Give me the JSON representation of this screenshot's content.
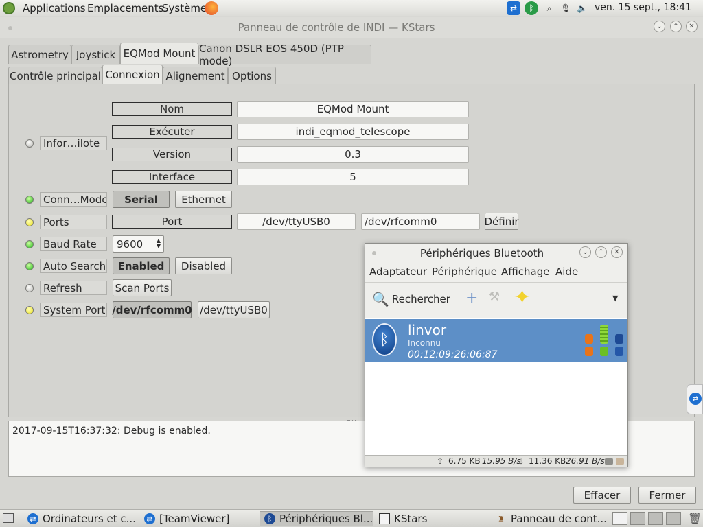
{
  "top_panel": {
    "menus": [
      "Applications",
      "Emplacements",
      "Système"
    ],
    "clock": "ven. 15 sept., 18:41"
  },
  "window": {
    "title": "Panneau de contrôle de INDI — KStars",
    "tabs": [
      "Astrometry",
      "Joystick",
      "EQMod Mount",
      "Canon DSLR EOS 450D (PTP mode)"
    ],
    "active_tab": "EQMod Mount",
    "subtabs": [
      "Contrôle principal",
      "Connexion",
      "Alignement",
      "Options"
    ],
    "active_subtab": "Connexion",
    "driver_info": {
      "label": "Infor…ilote",
      "fields": [
        {
          "label": "Nom",
          "value": "EQMod Mount"
        },
        {
          "label": "Exécuter",
          "value": "indi_eqmod_telescope"
        },
        {
          "label": "Version",
          "value": "0.3"
        },
        {
          "label": "Interface",
          "value": "5"
        }
      ]
    },
    "connection_mode": {
      "label": "Conn…Mode",
      "options": [
        "Serial",
        "Ethernet"
      ],
      "selected": "Serial"
    },
    "ports": {
      "label": "Ports",
      "field_label": "Port",
      "current": "/dev/ttyUSB0",
      "new": "/dev/rfcomm0",
      "set_label": "Définir"
    },
    "baud_rate": {
      "label": "Baud Rate",
      "value": "9600"
    },
    "auto_search": {
      "label": "Auto Search",
      "options": [
        "Enabled",
        "Disabled"
      ],
      "selected": "Enabled"
    },
    "refresh": {
      "label": "Refresh",
      "button": "Scan Ports"
    },
    "system_ports": {
      "label": "System Ports",
      "options": [
        "/dev/rfcomm0",
        "/dev/ttyUSB0"
      ],
      "selected": "/dev/rfcomm0"
    },
    "log": "2017-09-15T16:37:32: Debug is enabled.",
    "buttons": {
      "clear": "Effacer",
      "close": "Fermer"
    }
  },
  "bluetooth": {
    "title": "Périphériques Bluetooth",
    "menus": [
      "Adaptateur",
      "Périphérique",
      "Affichage",
      "Aide"
    ],
    "search_label": "Rechercher",
    "device": {
      "name": "linvor",
      "status": "Inconnu",
      "address": "00:12:09:26:06:87"
    },
    "status": {
      "up": "6.75 KB",
      "up_rate": "15.95 B/s",
      "down": "11.36 KB",
      "down_rate": "26.91 B/s"
    }
  },
  "taskbar": {
    "tasks": [
      "Ordinateurs et c...",
      "[TeamViewer]",
      "Périphériques Bl...",
      "KStars",
      "Panneau de cont..."
    ]
  },
  "colors": {
    "accent": "#5d8fc7",
    "led_green": "#22b51a",
    "led_yellow": "#e8df1d"
  }
}
